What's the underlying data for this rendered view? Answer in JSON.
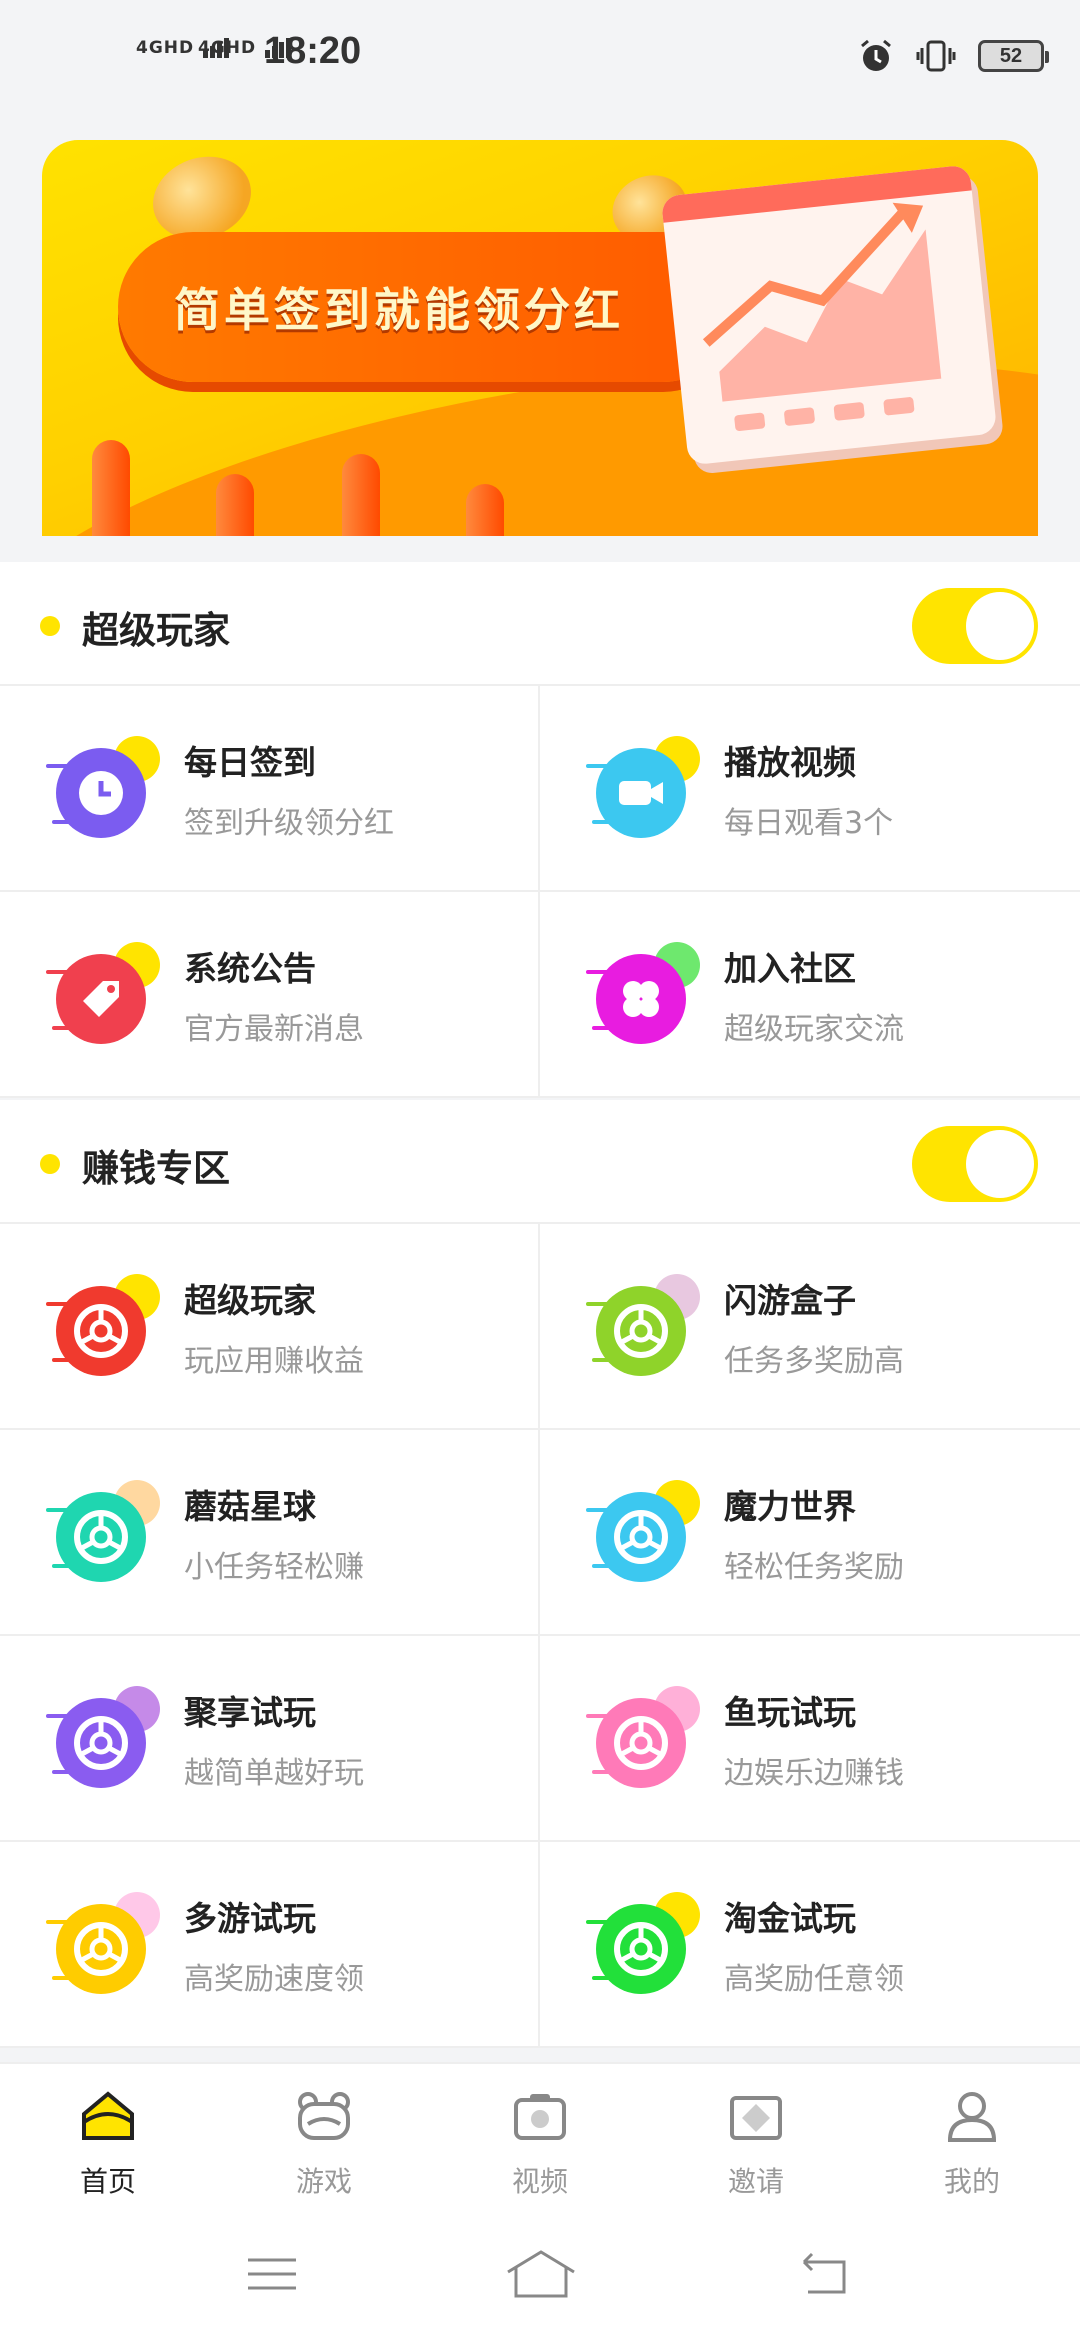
{
  "status_bar": {
    "network_1": "4GHD",
    "network_2": "4GHD",
    "time": "18:20",
    "battery": "52",
    "icons": [
      "alarm-icon",
      "vibrate-icon",
      "battery-icon"
    ]
  },
  "banner": {
    "headline": "简单签到就能领分红"
  },
  "super_player": {
    "title": "超级玩家",
    "toggle_on": true,
    "items": [
      {
        "title": "每日签到",
        "subtitle": "签到升级领分红",
        "icon": "clock-icon",
        "color": "#7b5cf0",
        "accent": "#ffe400"
      },
      {
        "title": "播放视频",
        "subtitle": "每日观看3个",
        "icon": "video-camera-icon",
        "color": "#3cc8f0",
        "accent": "#ffe400"
      },
      {
        "title": "系统公告",
        "subtitle": "官方最新消息",
        "icon": "tag-icon",
        "color": "#f0404e",
        "accent": "#ffe400"
      },
      {
        "title": "加入社区",
        "subtitle": "超级玩家交流",
        "icon": "clover-icon",
        "color": "#e81ce0",
        "accent": "#6ee86e"
      }
    ]
  },
  "earn_zone": {
    "title": "赚钱专区",
    "toggle_on": true,
    "items": [
      {
        "title": "超级玩家",
        "subtitle": "玩应用赚收益",
        "icon": "browser-icon",
        "color": "#f03a2e",
        "accent": "#ffe400"
      },
      {
        "title": "闪游盒子",
        "subtitle": "任务多奖励高",
        "icon": "browser-icon",
        "color": "#8fd32a",
        "accent": "#e8c8e0"
      },
      {
        "title": "蘑菇星球",
        "subtitle": "小任务轻松赚",
        "icon": "browser-icon",
        "color": "#1fd6b0",
        "accent": "#ffd8a0"
      },
      {
        "title": "魔力世界",
        "subtitle": "轻松任务奖励",
        "icon": "browser-icon",
        "color": "#3cc8f0",
        "accent": "#ffe400"
      },
      {
        "title": "聚享试玩",
        "subtitle": "越简单越好玩",
        "icon": "browser-icon",
        "color": "#8a5cf0",
        "accent": "#c58ae8"
      },
      {
        "title": "鱼玩试玩",
        "subtitle": "边娱乐边赚钱",
        "icon": "browser-icon",
        "color": "#ff7ab8",
        "accent": "#ffb0d8"
      },
      {
        "title": "多游试玩",
        "subtitle": "高奖励速度领",
        "icon": "browser-icon",
        "color": "#ffcc00",
        "accent": "#ffc8e8"
      },
      {
        "title": "淘金试玩",
        "subtitle": "高奖励任意领",
        "icon": "browser-icon",
        "color": "#22e03a",
        "accent": "#ffe400"
      }
    ]
  },
  "bottom_nav": {
    "items": [
      {
        "label": "首页",
        "icon": "home-icon",
        "active": true
      },
      {
        "label": "游戏",
        "icon": "game-icon",
        "active": false
      },
      {
        "label": "视频",
        "icon": "video-icon",
        "active": false
      },
      {
        "label": "邀请",
        "icon": "invite-icon",
        "active": false
      },
      {
        "label": "我的",
        "icon": "profile-icon",
        "active": false
      }
    ]
  },
  "system_nav": {
    "icons": [
      "menu-icon",
      "home-outline-icon",
      "back-icon"
    ]
  }
}
